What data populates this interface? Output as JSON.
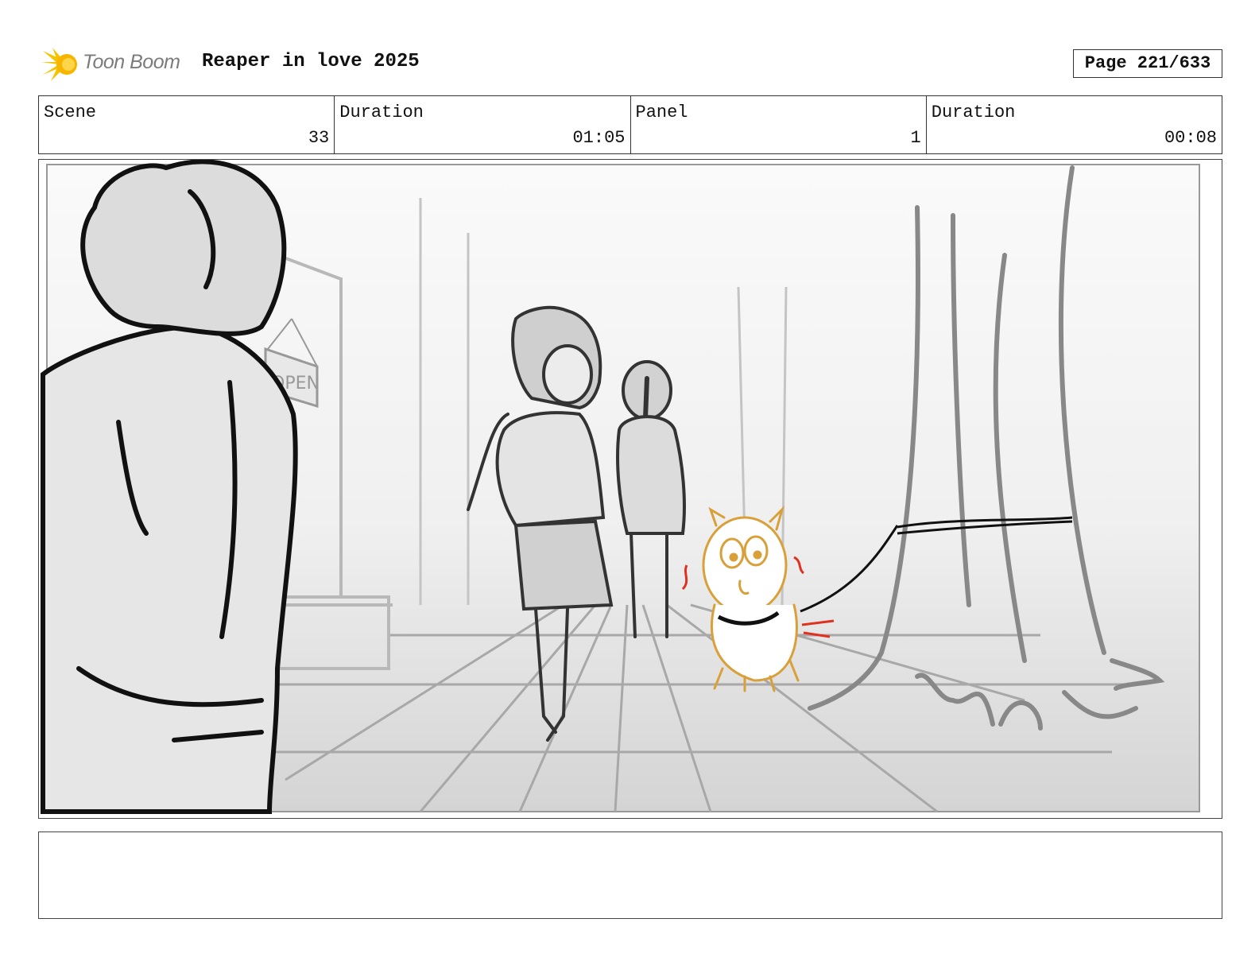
{
  "header": {
    "logo_text": "Toon Boom",
    "logo_icon": "starburst-icon",
    "project_title": "Reaper in love 2025",
    "page_label": "Page 221/633"
  },
  "info": {
    "scene": {
      "label": "Scene",
      "value": "33"
    },
    "scene_duration": {
      "label": "Duration",
      "value": "01:05"
    },
    "panel": {
      "label": "Panel",
      "value": "1"
    },
    "panel_duration": {
      "label": "Duration",
      "value": "00:08"
    }
  },
  "panel_image": {
    "description_visible": false,
    "sign_text": "OPEN",
    "colors": {
      "dog": "#d9a03a",
      "accent": "#e03020",
      "sketch": "#111111",
      "background_light": "#f6f6f6",
      "background_dark": "#d6d6d6"
    }
  },
  "notes": {
    "text": ""
  }
}
